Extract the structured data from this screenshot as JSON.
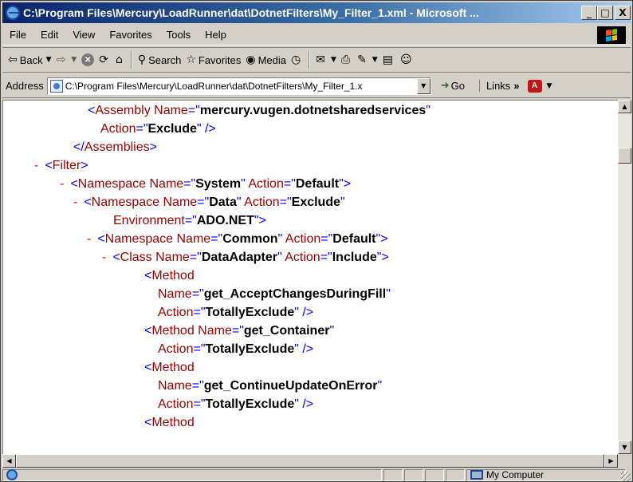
{
  "window": {
    "title": "C:\\Program Files\\Mercury\\LoadRunner\\dat\\DotnetFilters\\My_Filter_1.xml - Microsoft ...",
    "minimize": "_",
    "maximize": "□",
    "close": "X"
  },
  "menu": [
    "File",
    "Edit",
    "View",
    "Favorites",
    "Tools",
    "Help"
  ],
  "toolbar": {
    "back": "Back",
    "search": "Search",
    "favorites": "Favorites",
    "media": "Media"
  },
  "address": {
    "label": "Address",
    "value": "C:\\Program Files\\Mercury\\LoadRunner\\dat\\DotnetFilters\\My_Filter_1.x",
    "go": "Go",
    "links": "Links"
  },
  "xml": [
    {
      "dash": "",
      "parts": [
        [
          "brk",
          "<"
        ],
        [
          "tag",
          "Assembly Name"
        ],
        [
          "brk",
          "=\""
        ],
        [
          "val",
          "mercury.vugen.dotnetsharedservices"
        ],
        [
          "brk",
          "\""
        ]
      ]
    },
    {
      "dash": "",
      "parts": [
        [
          "tag",
          "Action"
        ],
        [
          "brk",
          "=\""
        ],
        [
          "val",
          "Exclude"
        ],
        [
          "brk",
          "\" />"
        ]
      ]
    },
    {
      "dash": "",
      "parts": [
        [
          "brk",
          "</"
        ],
        [
          "tag",
          "Assemblies"
        ],
        [
          "brk",
          ">"
        ]
      ]
    },
    {
      "dash": "-",
      "parts": [
        [
          "brk",
          "<"
        ],
        [
          "tag",
          "Filter"
        ],
        [
          "brk",
          ">"
        ]
      ]
    },
    {
      "dash": "-",
      "parts": [
        [
          "brk",
          "<"
        ],
        [
          "tag",
          "Namespace Name"
        ],
        [
          "brk",
          "=\""
        ],
        [
          "val",
          "System"
        ],
        [
          "brk",
          "\" "
        ],
        [
          "tag",
          "Action"
        ],
        [
          "brk",
          "=\""
        ],
        [
          "val",
          "Default"
        ],
        [
          "brk",
          "\">"
        ]
      ]
    },
    {
      "dash": "-",
      "parts": [
        [
          "brk",
          "<"
        ],
        [
          "tag",
          "Namespace Name"
        ],
        [
          "brk",
          "=\""
        ],
        [
          "val",
          "Data"
        ],
        [
          "brk",
          "\" "
        ],
        [
          "tag",
          "Action"
        ],
        [
          "brk",
          "=\""
        ],
        [
          "val",
          "Exclude"
        ],
        [
          "brk",
          "\""
        ]
      ]
    },
    {
      "dash": "",
      "parts": [
        [
          "tag",
          "Environment"
        ],
        [
          "brk",
          "=\""
        ],
        [
          "val",
          "ADO.NET"
        ],
        [
          "brk",
          "\">"
        ]
      ]
    },
    {
      "dash": "-",
      "parts": [
        [
          "brk",
          "<"
        ],
        [
          "tag",
          "Namespace Name"
        ],
        [
          "brk",
          "=\""
        ],
        [
          "val",
          "Common"
        ],
        [
          "brk",
          "\" "
        ],
        [
          "tag",
          "Action"
        ],
        [
          "brk",
          "=\""
        ],
        [
          "val",
          "Default"
        ],
        [
          "brk",
          "\">"
        ]
      ]
    },
    {
      "dash": "-",
      "parts": [
        [
          "brk",
          "<"
        ],
        [
          "tag",
          "Class Name"
        ],
        [
          "brk",
          "=\""
        ],
        [
          "val",
          "DataAdapter"
        ],
        [
          "brk",
          "\" "
        ],
        [
          "tag",
          "Action"
        ],
        [
          "brk",
          "=\""
        ],
        [
          "val",
          "Include"
        ],
        [
          "brk",
          "\">"
        ]
      ]
    },
    {
      "dash": "",
      "parts": [
        [
          "brk",
          "<"
        ],
        [
          "tag",
          "Method"
        ]
      ]
    },
    {
      "dash": "",
      "parts": [
        [
          "tag",
          "Name"
        ],
        [
          "brk",
          "=\""
        ],
        [
          "val",
          "get_AcceptChangesDuringFill"
        ],
        [
          "brk",
          "\""
        ]
      ]
    },
    {
      "dash": "",
      "parts": [
        [
          "tag",
          "Action"
        ],
        [
          "brk",
          "=\""
        ],
        [
          "val",
          "TotallyExclude"
        ],
        [
          "brk",
          "\" />"
        ]
      ]
    },
    {
      "dash": "",
      "parts": [
        [
          "brk",
          "<"
        ],
        [
          "tag",
          "Method Name"
        ],
        [
          "brk",
          "=\""
        ],
        [
          "val",
          "get_Container"
        ],
        [
          "brk",
          "\""
        ]
      ]
    },
    {
      "dash": "",
      "parts": [
        [
          "tag",
          "Action"
        ],
        [
          "brk",
          "=\""
        ],
        [
          "val",
          "TotallyExclude"
        ],
        [
          "brk",
          "\" />"
        ]
      ]
    },
    {
      "dash": "",
      "parts": [
        [
          "brk",
          "<"
        ],
        [
          "tag",
          "Method"
        ]
      ]
    },
    {
      "dash": "",
      "parts": [
        [
          "tag",
          "Name"
        ],
        [
          "brk",
          "=\""
        ],
        [
          "val",
          "get_ContinueUpdateOnError"
        ],
        [
          "brk",
          "\""
        ]
      ]
    },
    {
      "dash": "",
      "parts": [
        [
          "tag",
          "Action"
        ],
        [
          "brk",
          "=\""
        ],
        [
          "val",
          "TotallyExclude"
        ],
        [
          "brk",
          "\" />"
        ]
      ]
    },
    {
      "dash": "",
      "parts": [
        [
          "brk",
          "<"
        ],
        [
          "tag",
          "Method"
        ]
      ]
    }
  ],
  "status": {
    "zone": "My Computer"
  }
}
